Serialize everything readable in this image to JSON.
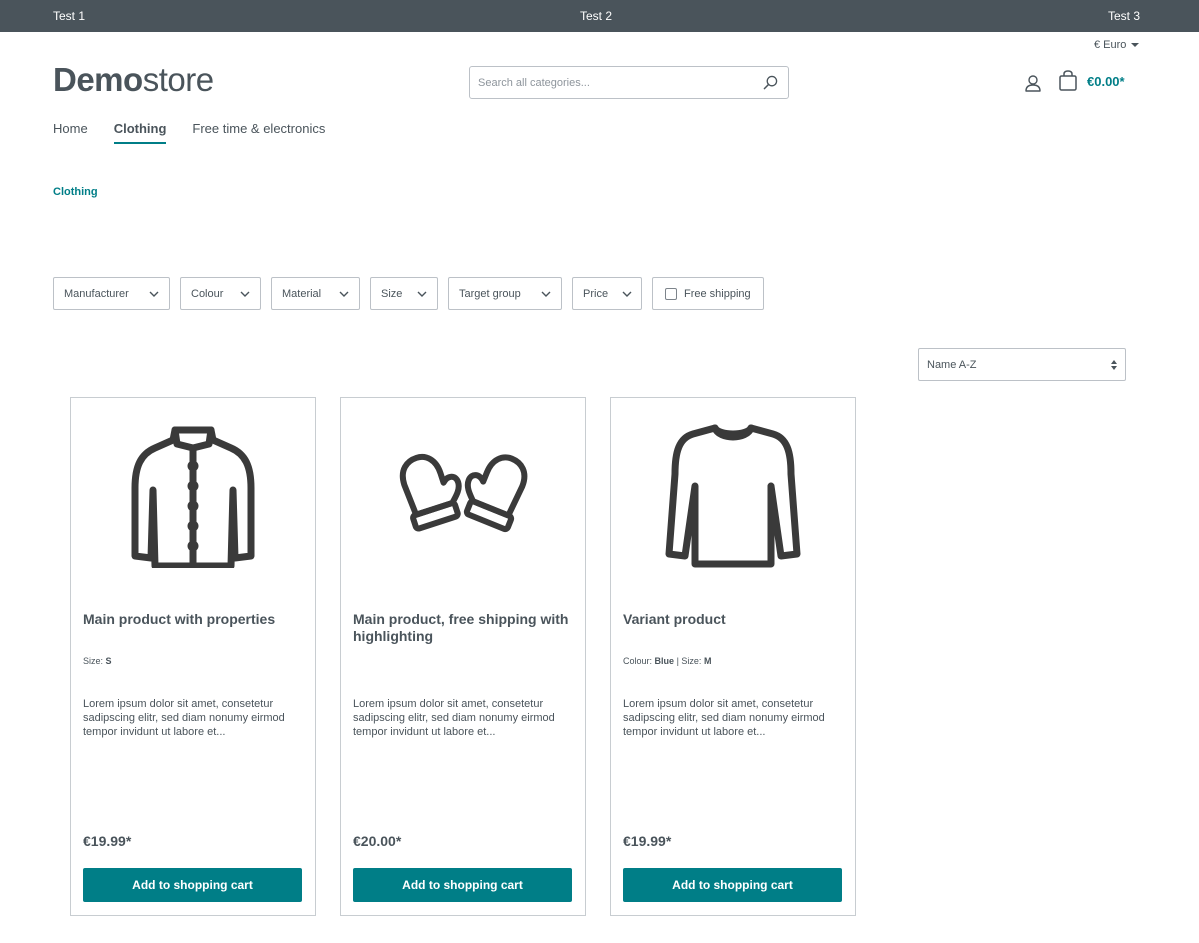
{
  "topbar": {
    "links": [
      "Test 1",
      "Test 2",
      "Test 3"
    ]
  },
  "header": {
    "currency": "€ Euro",
    "logo_bold": "Demo",
    "logo_light": "store",
    "search_placeholder": "Search all categories...",
    "cart_total": "€0.00*"
  },
  "nav": {
    "items": [
      "Home",
      "Clothing",
      "Free time & electronics"
    ],
    "active": "Clothing"
  },
  "breadcrumb": "Clothing",
  "filters": {
    "manufacturer": "Manufacturer",
    "colour": "Colour",
    "material": "Material",
    "size": "Size",
    "target_group": "Target group",
    "price": "Price",
    "free_shipping": "Free shipping"
  },
  "sort": {
    "selected": "Name A-Z"
  },
  "products": [
    {
      "name": "Main product with properties",
      "props": [
        {
          "label": "Size:",
          "value": "S"
        }
      ],
      "description": "Lorem ipsum dolor sit amet, consetetur sadipscing elitr, sed diam nonumy eirmod tempor invidunt ut labore et...",
      "price": "€19.99*",
      "button": "Add to shopping cart",
      "icon": "jacket-icon"
    },
    {
      "name": "Main product, free shipping with highlighting",
      "props": [],
      "description": "Lorem ipsum dolor sit amet, consetetur sadipscing elitr, sed diam nonumy eirmod tempor invidunt ut labore et...",
      "price": "€20.00*",
      "button": "Add to shopping cart",
      "icon": "mittens-icon"
    },
    {
      "name": "Variant product",
      "props": [
        {
          "label": "Colour:",
          "value": "Blue"
        },
        {
          "label": "Size:",
          "value": "M"
        }
      ],
      "description": "Lorem ipsum dolor sit amet, consetetur sadipscing elitr, sed diam nonumy eirmod tempor invidunt ut labore et...",
      "price": "€19.99*",
      "button": "Add to shopping cart",
      "icon": "longsleeve-shirt-icon"
    }
  ],
  "colors": {
    "accent": "#007e87",
    "text": "#4a545b",
    "topbar": "#4a545b"
  }
}
